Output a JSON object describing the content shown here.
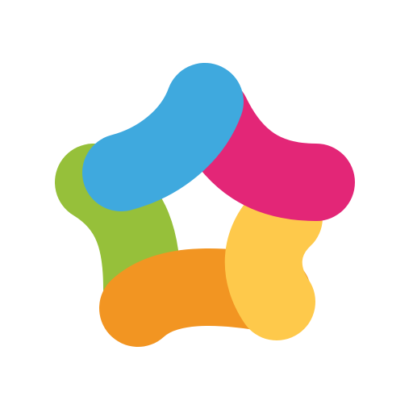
{
  "logo": {
    "icon": "star-pinwheel-logo-icon",
    "petals": [
      {
        "name": "green",
        "color": "#96C03A"
      },
      {
        "name": "orange",
        "color": "#F29522"
      },
      {
        "name": "yellow",
        "color": "#FEC94B"
      },
      {
        "name": "pink",
        "color": "#E32677"
      },
      {
        "name": "blue",
        "color": "#3FA9DE"
      }
    ]
  }
}
